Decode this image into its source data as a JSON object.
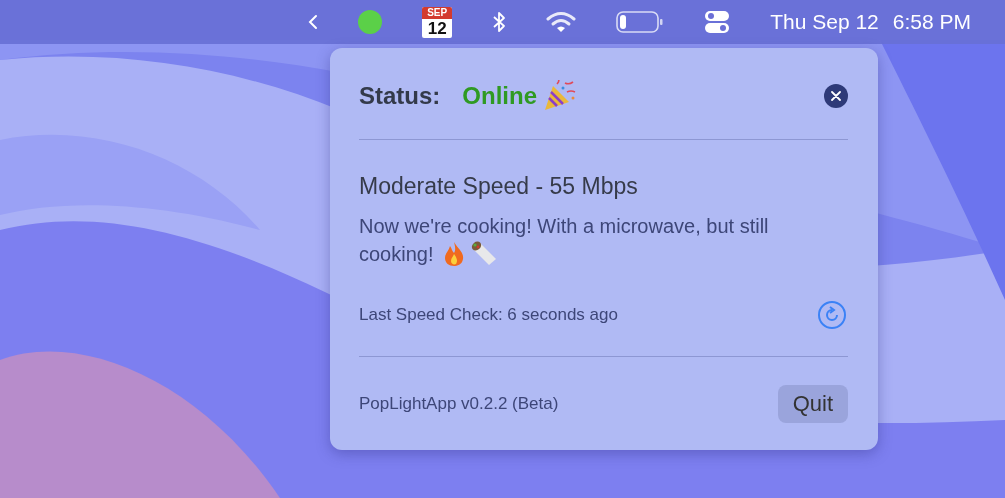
{
  "menu_bar": {
    "calendar_month": "SEP",
    "calendar_day": "12",
    "clock_date": "Thu Sep 12",
    "clock_time": "6:58 PM"
  },
  "popover": {
    "status_label": "Status:",
    "status_value": "Online",
    "online": true,
    "speed_title": "Moderate Speed - 55 Mbps",
    "message_lines": [
      "Now we're cooking! With a microwave, but still",
      "cooking!"
    ],
    "last_check": "Last Speed Check: 6 seconds ago",
    "version": "PopLightApp v0.2.2 (Beta)",
    "quit_button": "Quit"
  }
}
